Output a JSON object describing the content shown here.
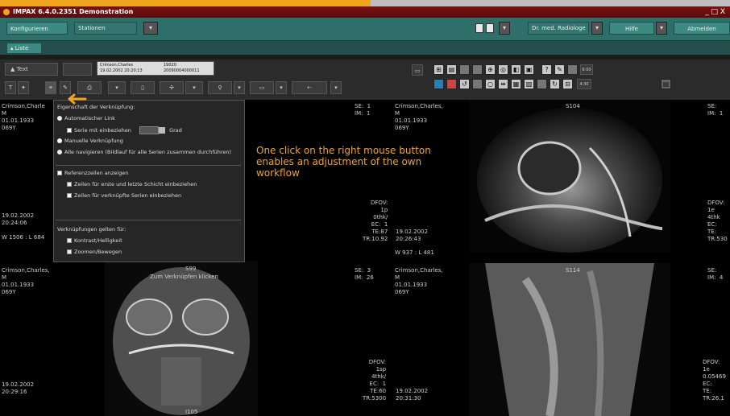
{
  "window": {
    "title": "IMPAX 6.4.0.2351 Demonstration",
    "controls": "_ □ X"
  },
  "toolbar_top": {
    "konfigurieren": "Konfigurieren",
    "stationen": "Stationen",
    "user": "Dr. med. Radiologe",
    "hilfe": "Hilfe",
    "abmelden": "Abmelden"
  },
  "toolbar_liste": {
    "liste": "Liste"
  },
  "toolbar_viewer": {
    "text": "Text",
    "patient": {
      "name": "Crimson,Charles",
      "id": "19020",
      "date": "19.02.2002  20:20:13",
      "acc": "20090004000011"
    },
    "count_a": "6:00",
    "count_b": "4:30"
  },
  "popup": {
    "header": "Eigenschaft der Verknüpfung:",
    "auto_link": "Automatischer Link",
    "include_series": "Serie mit einbeziehen",
    "grad_value": "",
    "grad_label": "Grad",
    "manual_link": "Manuelle Verknüpfung",
    "navigate_all": "Alle navigieren (Bildlauf für alle Serien zusammen durchführen)",
    "show_ref_lines": "Referenzzeilen anzeigen",
    "first_last": "Zeilen für erste und letzte Schicht einbeziehen",
    "linked_series": "Zeilen für verknüpfte Serien einbeziehen",
    "applies_for": "Verknüpfungen gelten für:",
    "contrast": "Kontrast/Helligkeit",
    "zoom": "Zoomen/Bewegen"
  },
  "callout": {
    "text": "One click on the right mouse button enables an adjustment of the own workflow"
  },
  "cells": {
    "c1_tl": "Crimson,Charle\nM\n01.01.1933\n069Y",
    "c1_bl": "19.02.2002\n20:24:06\n\nW 1506 : L 684",
    "c2_tr": "SE:  1\nIM:  1",
    "c2_pat": "Crimson,Charles,\nM\n01.01.1933\n069Y",
    "c2_dfov": "DFOV:\n1p\n0thk/\nEC:  1\nTE:87\nTR:10.92",
    "c2_date": "19.02.2002\n20:26:43",
    "c2_wl": "W 937 : L 481",
    "c2_img_label": "S104",
    "c3_tr": "SE:\nIM:  1",
    "c3_dfov": "DFOV:\n1e\n4thk\nEC:\nTE:\nTR:530",
    "r2_c1_tl": "Crimson,Charles,\nM\n01.01.1933\n069Y",
    "r2_c1_top": "S99",
    "r2_c1_sub": "Zum Verknüpfen klicken",
    "r2_c1_bl": "19.02.2002\n20:29:16",
    "r2_c1_bottom": "I105",
    "r2_c2_tr": "SE:  3\nIM:  26",
    "r2_c2_pat": "Crimson,Charles,\nM\n01.01.1933\n069Y",
    "r2_c2_label": "S114",
    "r2_c2_dfov": "DFOV:\n1sp\n4thk/\nEC:  1\nTE:60\nTR:5300",
    "r2_c2_date": "19.02.2002\n20:31:30",
    "r2_c3_tr": "SE:\nIM:  4",
    "r2_c3_dfov": "DFOV:\n1e\n0.05469\nEC:\nTE:\nTR:26.1"
  },
  "colors": {
    "accent": "#f0a51e",
    "toolbar": "#2e6f6a",
    "titlebar": "#7a1212"
  }
}
